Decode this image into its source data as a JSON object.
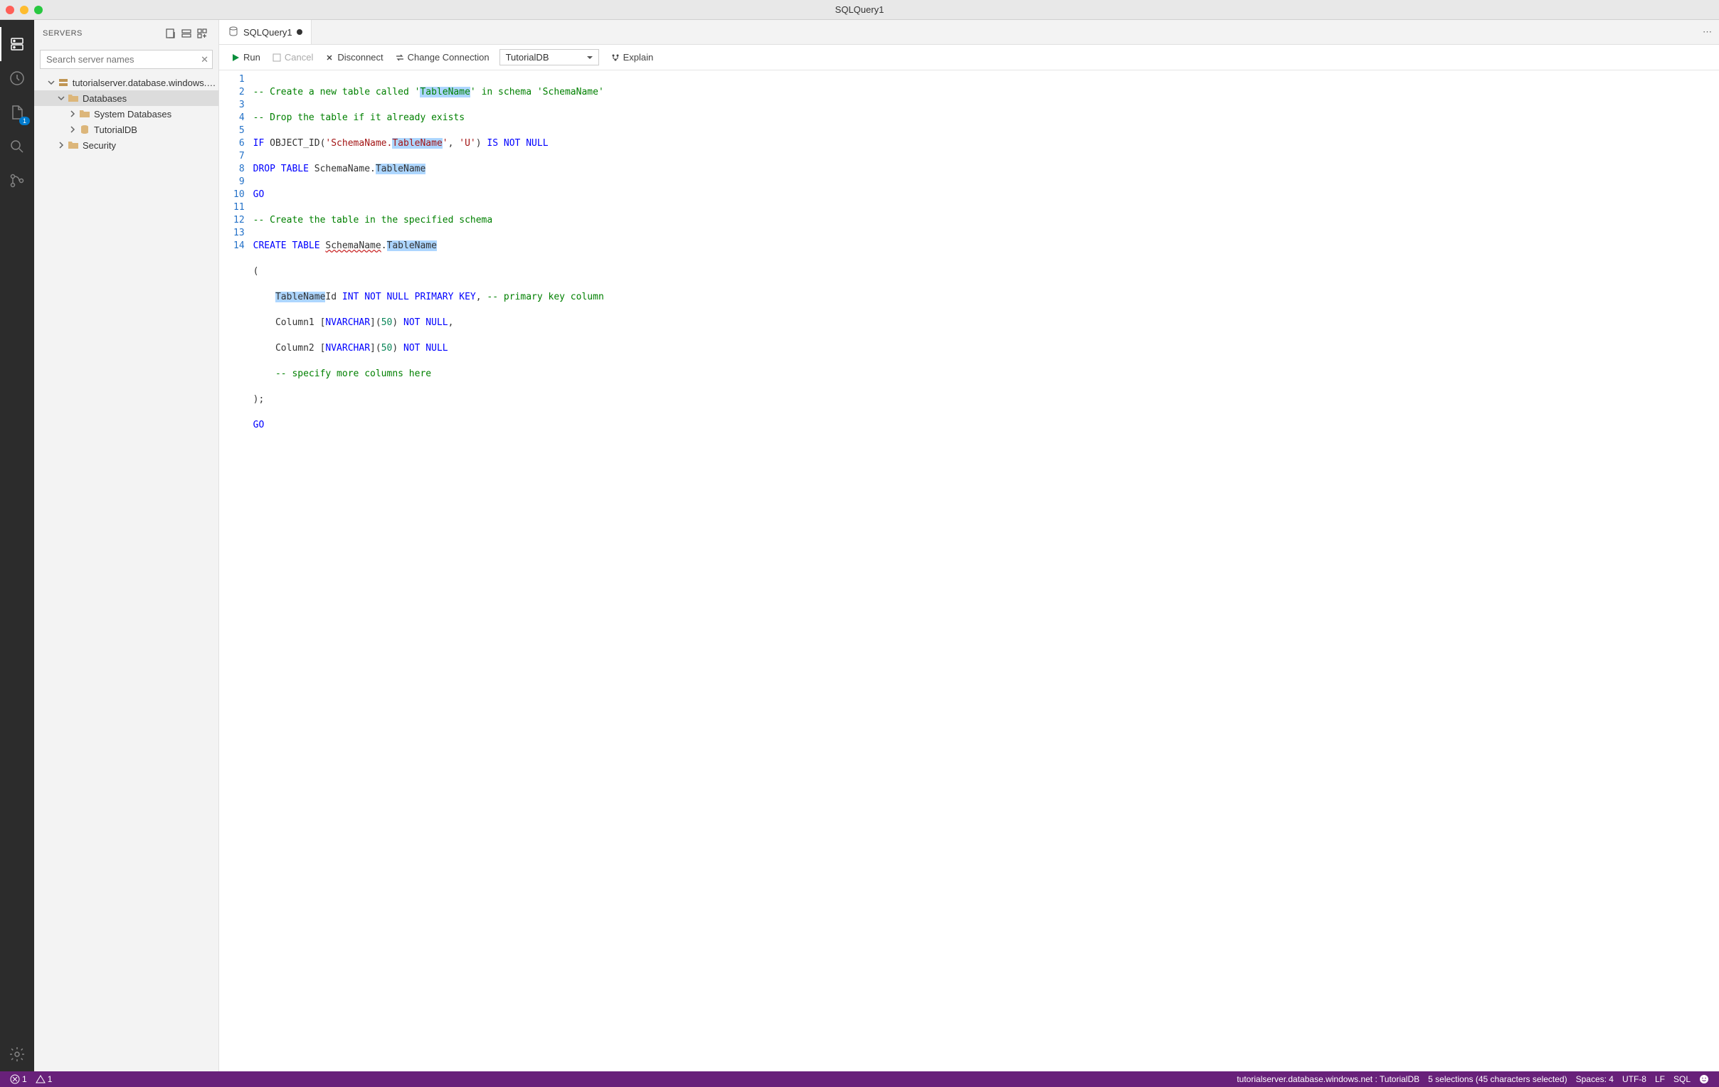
{
  "window": {
    "title": "SQLQuery1"
  },
  "sidebar": {
    "header": "SERVERS",
    "search_placeholder": "Search server names",
    "tree": {
      "server": "tutorialserver.database.windows.n...",
      "databases": "Databases",
      "sysdb": "System Databases",
      "tutorialdb": "TutorialDB",
      "security": "Security"
    }
  },
  "tab": {
    "label": "SQLQuery1"
  },
  "toolbar": {
    "run": "Run",
    "cancel": "Cancel",
    "disconnect": "Disconnect",
    "change_conn": "Change Connection",
    "db": "TutorialDB",
    "explain": "Explain"
  },
  "code": {
    "l1_a": "-- Create a new table called '",
    "l1_b": "TableName",
    "l1_c": "' in schema '",
    "l1_d": "SchemaName",
    "l1_e": "'",
    "l2": "-- Drop the table if it already exists",
    "l3_a": "IF",
    "l3_b": " OBJECT_ID(",
    "l3_c": "'",
    "l3_d": "SchemaName",
    "l3_e": ".",
    "l3_f": "TableName",
    "l3_g": "'",
    "l3_h": ", ",
    "l3_i": "'U'",
    "l3_j": ") ",
    "l3_k": "IS NOT NULL",
    "l4_a": "DROP TABLE",
    "l4_b": " SchemaName.",
    "l4_c": "TableName",
    "l5": "GO",
    "l6": "-- Create the table in the specified schema",
    "l7_a": "CREATE TABLE",
    "l7_b": " ",
    "l7_c": "SchemaName",
    "l7_d": ".",
    "l7_e": "TableName",
    "l8": "(",
    "l9_a": "    ",
    "l9_b": "TableName",
    "l9_c": "Id ",
    "l9_d": "INT NOT NULL PRIMARY KEY",
    "l9_e": ", ",
    "l9_f": "-- primary key column",
    "l10_a": "    Column1 [",
    "l10_b": "NVARCHAR",
    "l10_c": "](",
    "l10_d": "50",
    "l10_e": ") ",
    "l10_f": "NOT NULL",
    "l10_g": ",",
    "l11_a": "    Column2 [",
    "l11_b": "NVARCHAR",
    "l11_c": "](",
    "l11_d": "50",
    "l11_e": ") ",
    "l11_f": "NOT NULL",
    "l12": "    -- specify more columns here",
    "l13": ");",
    "l14": "GO"
  },
  "statusbar": {
    "errors": "1",
    "warnings": "1",
    "connection": "tutorialserver.database.windows.net : TutorialDB",
    "selections": "5 selections (45 characters selected)",
    "spaces": "Spaces: 4",
    "encoding": "UTF-8",
    "eol": "LF",
    "lang": "SQL"
  },
  "activity": {
    "files_badge": "1"
  }
}
